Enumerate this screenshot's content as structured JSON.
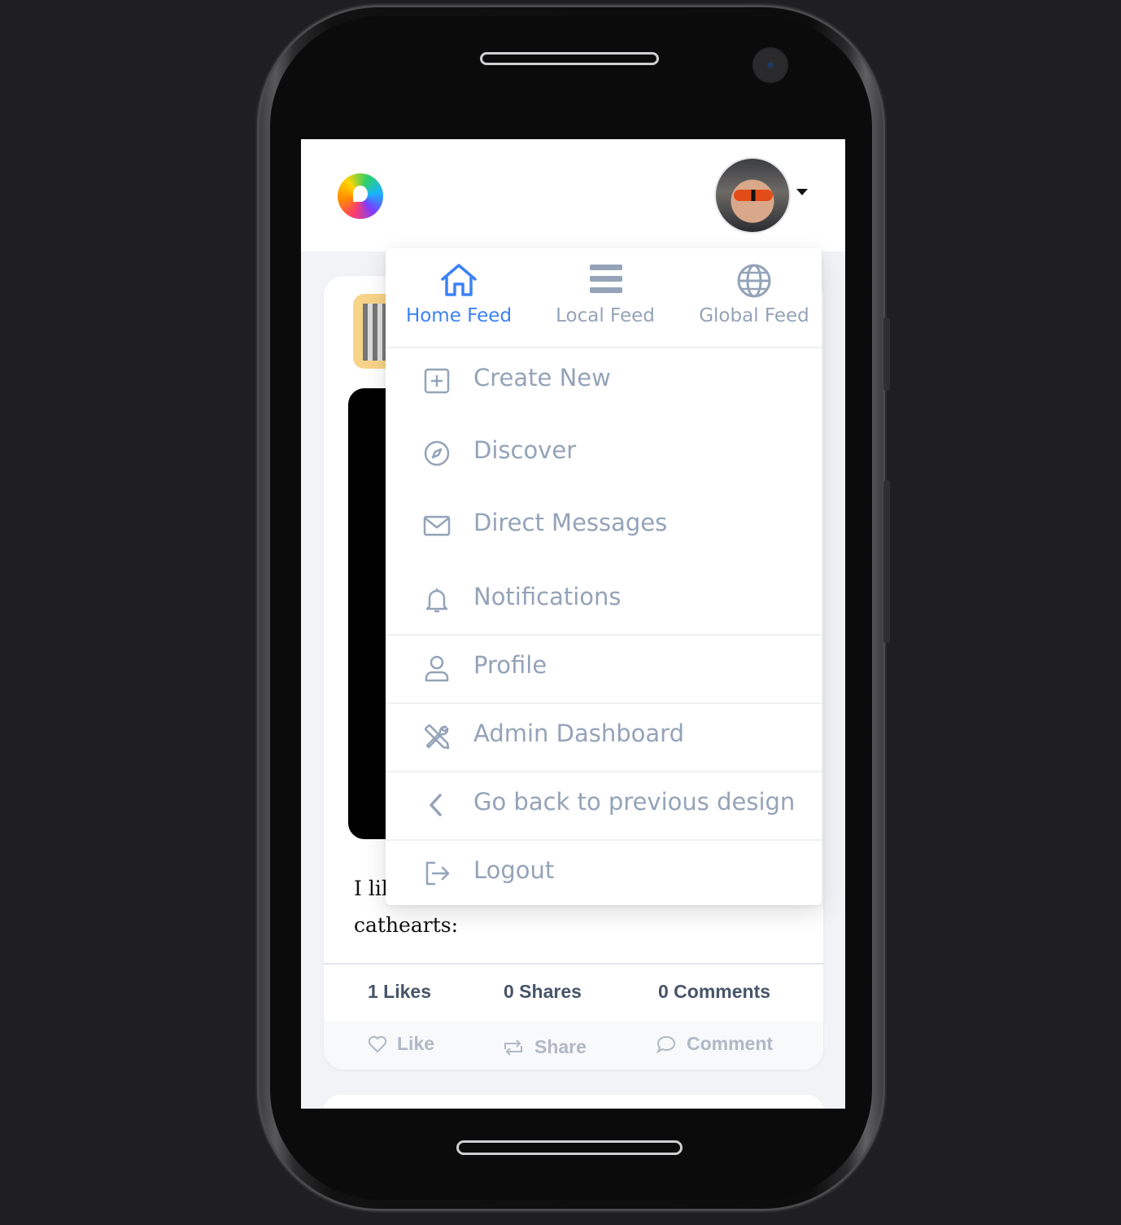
{
  "colors": {
    "accent": "#3b82f6",
    "muted": "#94a3b8",
    "stat_text": "#475569"
  },
  "feed_tabs": [
    {
      "label": "Home Feed",
      "icon": "home-icon",
      "active": true
    },
    {
      "label": "Local Feed",
      "icon": "menu-lines-icon",
      "active": false
    },
    {
      "label": "Global Feed",
      "icon": "globe-icon",
      "active": false
    }
  ],
  "menu_items": [
    {
      "label": "Create New",
      "icon": "plus-square-icon"
    },
    {
      "label": "Discover",
      "icon": "compass-icon"
    },
    {
      "label": "Direct Messages",
      "icon": "envelope-icon"
    },
    {
      "label": "Notifications",
      "icon": "bell-icon"
    },
    {
      "label": "Profile",
      "icon": "user-icon"
    },
    {
      "label": "Admin Dashboard",
      "icon": "tools-icon"
    },
    {
      "label": "Go back to previous design",
      "icon": "chevron-left-icon"
    },
    {
      "label": "Logout",
      "icon": "logout-icon"
    }
  ],
  "post": {
    "text_line1": "I lik",
    "text_line2": "cathearts:",
    "stats": {
      "likes": "1 Likes",
      "shares": "0 Shares",
      "comments": "0 Comments"
    },
    "actions": {
      "like": "Like",
      "share": "Share",
      "comment": "Comment"
    }
  }
}
